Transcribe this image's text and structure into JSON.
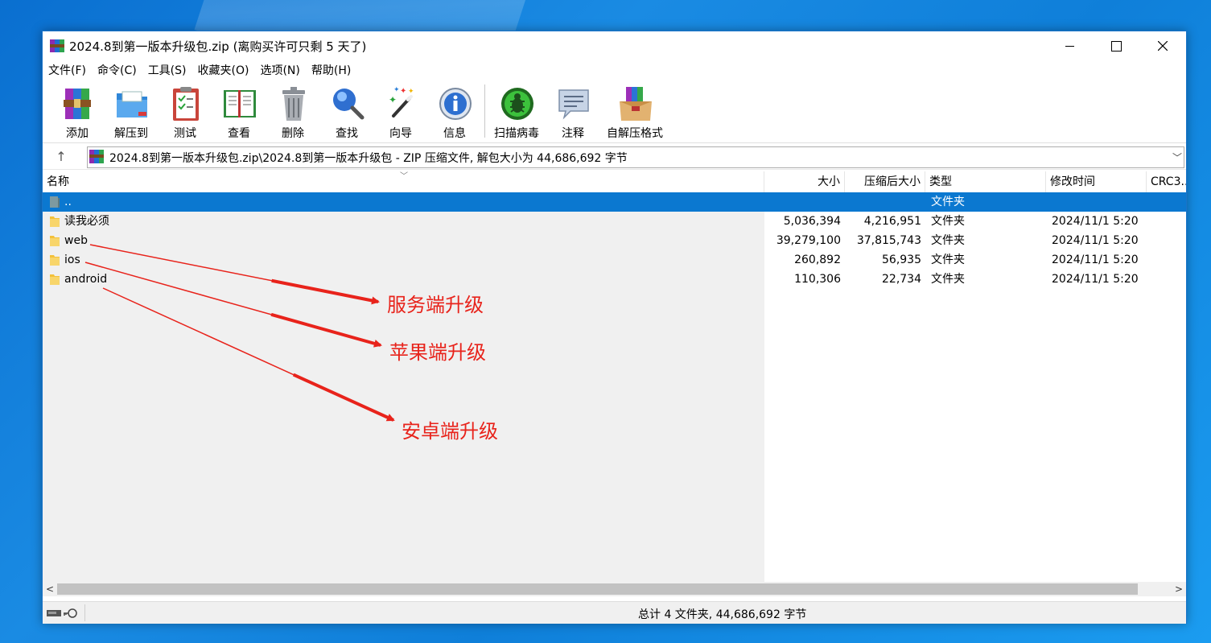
{
  "window": {
    "title": "2024.8到第一版本升级包.zip (离购买许可只剩 5 天了)"
  },
  "menu": [
    {
      "label": "文件(F)"
    },
    {
      "label": "命令(C)"
    },
    {
      "label": "工具(S)"
    },
    {
      "label": "收藏夹(O)"
    },
    {
      "label": "选项(N)"
    },
    {
      "label": "帮助(H)"
    }
  ],
  "toolbar": {
    "buttons": [
      {
        "label": "添加",
        "icon": "add-icon"
      },
      {
        "label": "解压到",
        "icon": "extract-icon"
      },
      {
        "label": "测试",
        "icon": "test-icon"
      },
      {
        "label": "查看",
        "icon": "view-icon"
      },
      {
        "label": "删除",
        "icon": "delete-icon"
      },
      {
        "label": "查找",
        "icon": "find-icon"
      },
      {
        "label": "向导",
        "icon": "wizard-icon"
      },
      {
        "label": "信息",
        "icon": "info-icon"
      },
      {
        "label": "扫描病毒",
        "icon": "virus-scan-icon"
      },
      {
        "label": "注释",
        "icon": "comment-icon"
      },
      {
        "label": "自解压格式",
        "icon": "sfx-icon"
      }
    ]
  },
  "address": {
    "up_label": "↑",
    "path": "2024.8到第一版本升级包.zip\\2024.8到第一版本升级包 - ZIP 压缩文件, 解包大小为 44,686,692 字节",
    "dropdown": "﹀"
  },
  "columns": {
    "name": "名称",
    "size": "大小",
    "packed": "压缩后大小",
    "type": "类型",
    "modified": "修改时间",
    "crc": "CRC3..."
  },
  "rows": [
    {
      "name": "..",
      "size": "",
      "packed": "",
      "type": "文件夹",
      "modified": ""
    },
    {
      "name": "读我必须",
      "size": "5,036,394",
      "packed": "4,216,951",
      "type": "文件夹",
      "modified": "2024/11/1 5:20"
    },
    {
      "name": "web",
      "size": "39,279,100",
      "packed": "37,815,743",
      "type": "文件夹",
      "modified": "2024/11/1 5:20"
    },
    {
      "name": "ios",
      "size": "260,892",
      "packed": "56,935",
      "type": "文件夹",
      "modified": "2024/11/1 5:20"
    },
    {
      "name": "android",
      "size": "110,306",
      "packed": "22,734",
      "type": "文件夹",
      "modified": "2024/11/1 5:20"
    }
  ],
  "annotations": [
    {
      "text": "服务端升级"
    },
    {
      "text": "苹果端升级"
    },
    {
      "text": "安卓端升级"
    }
  ],
  "status": {
    "text": "总计 4 文件夹, 44,686,692 字节"
  },
  "colors": {
    "selection": "#0b78d0",
    "annotation_red": "#e8231b",
    "folder_yellow": "#f3c13a"
  }
}
